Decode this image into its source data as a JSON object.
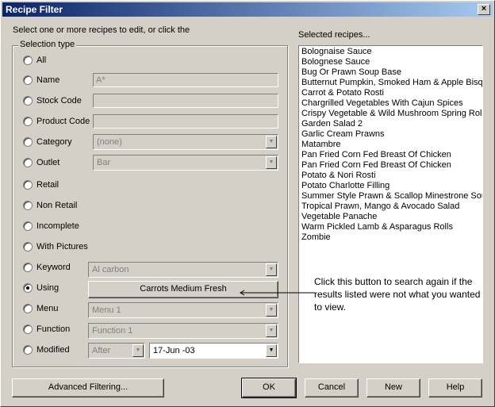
{
  "window": {
    "title": "Recipe Filter",
    "close_glyph": "×"
  },
  "instructions": "Select one or more recipes to edit, or click the",
  "selection_type": {
    "legend": "Selection type",
    "options": [
      {
        "label": "All",
        "checked": false
      },
      {
        "label": "Name",
        "value": "A*"
      },
      {
        "label": "Stock Code",
        "value": ""
      },
      {
        "label": "Product Code",
        "value": ""
      },
      {
        "label": "Category",
        "value": "(none)"
      },
      {
        "label": "Outlet",
        "value": "Bar"
      },
      {
        "label": "Retail"
      },
      {
        "label": "Non Retail"
      },
      {
        "label": "Incomplete"
      },
      {
        "label": "With Pictures"
      },
      {
        "label": "Keyword",
        "value": "Al carbon"
      },
      {
        "label": "Using",
        "value": "Carrots Medium Fresh",
        "checked": true
      },
      {
        "label": "Menu",
        "value": "Menu 1"
      },
      {
        "label": "Function",
        "value": "Function 1"
      },
      {
        "label": "Modified",
        "value": "After",
        "date": "17-Jun -03"
      }
    ]
  },
  "selected_recipes": {
    "label": "Selected recipes...",
    "items": [
      "Bolognaise Sauce",
      "Bolognese Sauce",
      "Bug Or Prawn Soup Base",
      "Butternut Pumpkin, Smoked Ham & Apple Bisque",
      "Carrot & Potato Rosti",
      "Chargrilled Vegetables With Cajun Spices",
      "Crispy Vegetable & Wild Mushroom Spring Rolls",
      "Garden Salad 2",
      "Garlic Cream Prawns",
      "Matambre",
      "Pan Fried Corn Fed Breast Of Chicken",
      "Pan Fried Corn Fed Breast Of Chicken",
      "Potato & Nori Rosti",
      "Potato Charlotte Filling",
      "Summer Style Prawn & Scallop Minestrone Soup",
      "Tropical Prawn, Mango & Avocado Salad",
      "Vegetable Panache",
      "Warm Pickled Lamb & Asparagus Rolls",
      "Zombie"
    ]
  },
  "callout": "Click this button to search again if the results listed were not what you wanted to view.",
  "buttons": {
    "advanced": "Advanced Filtering...",
    "ok": "OK",
    "cancel": "Cancel",
    "new": "New",
    "help": "Help"
  },
  "icons": {
    "dropdown_arrow": "▼"
  }
}
